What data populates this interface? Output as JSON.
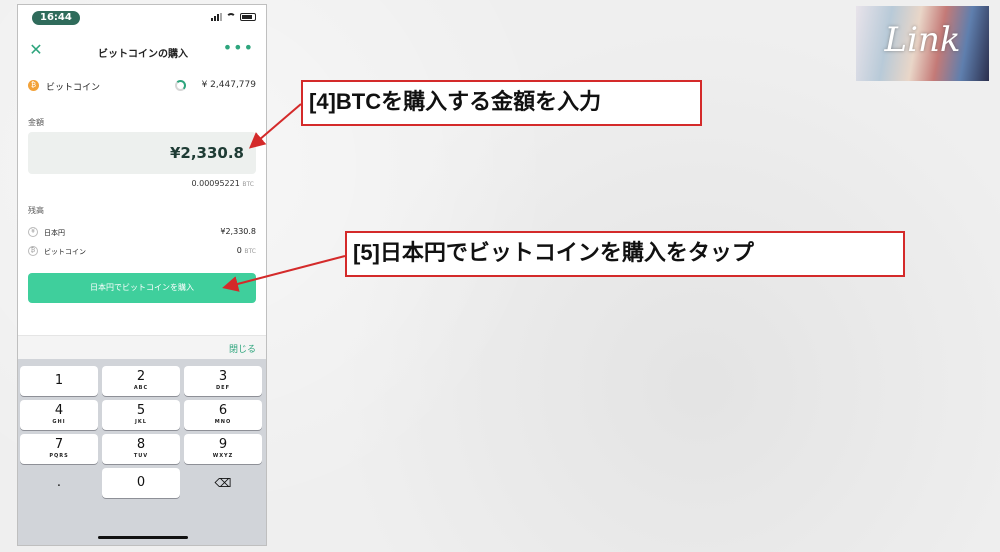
{
  "status_bar": {
    "time": "16:44"
  },
  "header": {
    "close_icon": "close-x-icon",
    "title": "ビットコインの購入",
    "more_icon": "more-dots-icon"
  },
  "coin": {
    "icon_label": "₿",
    "name": "ビットコイン",
    "price": "¥ 2,447,779"
  },
  "amount": {
    "label": "金額",
    "value": "¥2,330.8",
    "btc_value": "0.00095221",
    "btc_unit": "BTC"
  },
  "balance": {
    "label": "残高",
    "items": [
      {
        "icon": "¥",
        "name": "日本円",
        "value": "¥2,330.8",
        "unit": ""
      },
      {
        "icon": "₿",
        "name": "ビットコイン",
        "value": "0",
        "unit": "BTC"
      }
    ]
  },
  "buy_button": {
    "label": "日本円でビットコインを購入"
  },
  "keyboard": {
    "close_label": "閉じる",
    "keys": [
      {
        "digit": "1",
        "letters": ""
      },
      {
        "digit": "2",
        "letters": "ABC"
      },
      {
        "digit": "3",
        "letters": "DEF"
      },
      {
        "digit": "4",
        "letters": "GHI"
      },
      {
        "digit": "5",
        "letters": "JKL"
      },
      {
        "digit": "6",
        "letters": "MNO"
      },
      {
        "digit": "7",
        "letters": "PQRS"
      },
      {
        "digit": "8",
        "letters": "TUV"
      },
      {
        "digit": "9",
        "letters": "WXYZ"
      },
      {
        "digit": ".",
        "letters": ""
      },
      {
        "digit": "0",
        "letters": ""
      },
      {
        "digit": "⌫",
        "letters": ""
      }
    ]
  },
  "callouts": {
    "step4": "[4]BTCを購入する金額を入力",
    "step5": "[5]日本円でビットコインを購入をタップ"
  },
  "logo": {
    "text": "Link"
  },
  "colors": {
    "accent": "#3fcf9c",
    "callout_border": "#d42a2a",
    "status_pill": "#2f6b5b"
  }
}
